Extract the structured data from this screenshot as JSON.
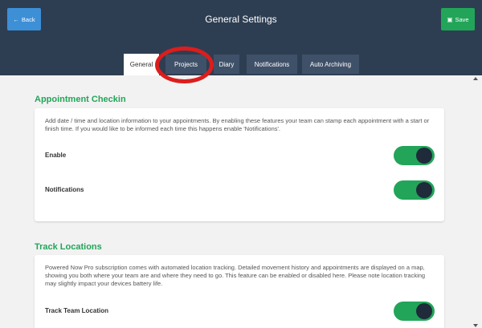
{
  "header": {
    "title": "General Settings",
    "back_label": "Back",
    "save_label": "Save"
  },
  "tabs": [
    {
      "label": "General",
      "active": true
    },
    {
      "label": "Projects",
      "active": false
    },
    {
      "label": "Diary",
      "active": false
    },
    {
      "label": "Notifications",
      "active": false
    },
    {
      "label": "Auto Archiving",
      "active": false
    }
  ],
  "sections": {
    "appointment_checkin": {
      "title": "Appointment Checkin",
      "description": "Add date / time and location information to your appointments. By enabling these features your team can stamp each appointment with a start or finish time. If you would like to be informed each time this happens enable 'Notifications'.",
      "rows": [
        {
          "label": "Enable",
          "on": true
        },
        {
          "label": "Notifications",
          "on": true
        }
      ]
    },
    "track_locations": {
      "title": "Track Locations",
      "description": "Powered Now Pro subscription comes with automated location tracking. Detailed movement history and appointments are displayed on a map, showing you both where your team are and where they need to go. This feature can be enabled or disabled here. Please note location tracking may slightly impact your devices battery life.",
      "rows": [
        {
          "label": "Track Team Location",
          "on": true
        }
      ]
    }
  },
  "colors": {
    "header_bg": "#2e3e52",
    "accent_green": "#22a559",
    "back_button": "#3d8fd6",
    "annotation": "#dc1d1d"
  }
}
